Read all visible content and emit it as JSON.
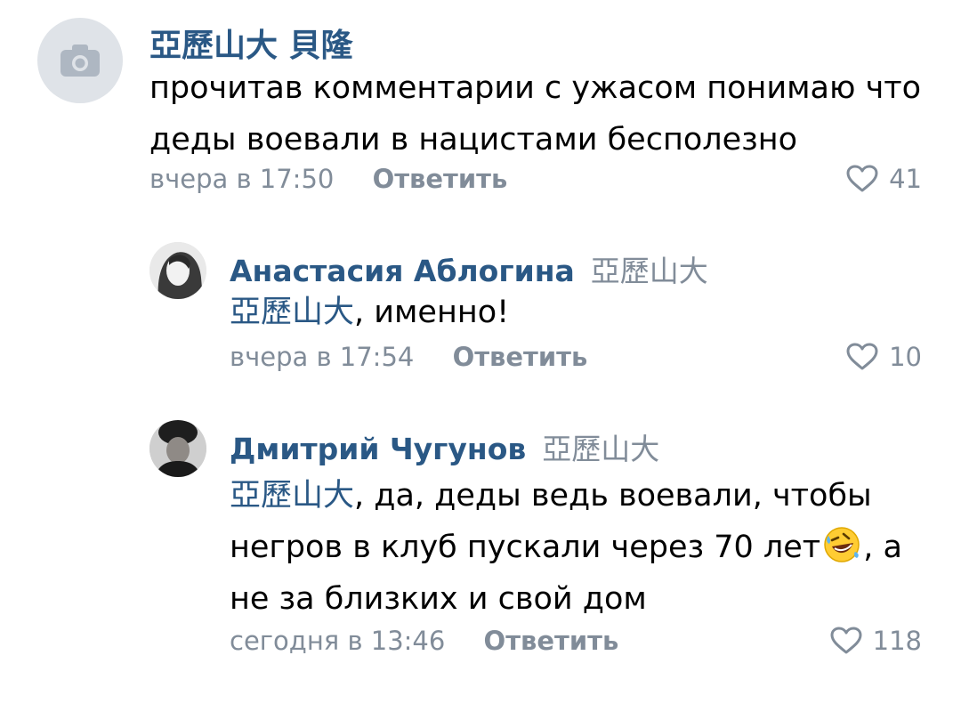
{
  "comments": [
    {
      "author": "亞歷山大 貝隆",
      "avatar_icon": "camera-icon",
      "text_lines": [
        "прочитав комментарии с ужасом понимаю что",
        "деды воевали в нацистами бесполезно"
      ],
      "time": "вчера в 17:50",
      "reply_label": "Ответить",
      "likes": "41"
    },
    {
      "author": "Анастасия Аблогина",
      "reply_to": "亞歷山大",
      "mention": "亞歷山大",
      "text": ", именно!",
      "time": "вчера в 17:54",
      "reply_label": "Ответить",
      "likes": "10"
    },
    {
      "author": "Дмитрий Чугунов",
      "reply_to": "亞歷山大",
      "mention": "亞歷山大",
      "text_part1": ", да, деды ведь воевали, чтобы",
      "text_part2": "негров в клуб пускали через 70 лет",
      "emoji": "rolling-on-floor-laughing-emoji",
      "text_part3": ", а",
      "text_part4": "не за близких и свой дом",
      "time": "сегодня в 13:46",
      "reply_label": "Ответить",
      "likes": "118"
    }
  ],
  "colors": {
    "link": "#2a5885",
    "secondary": "#818c99",
    "text": "#000000",
    "avatar_placeholder": "#dfe3e8"
  }
}
